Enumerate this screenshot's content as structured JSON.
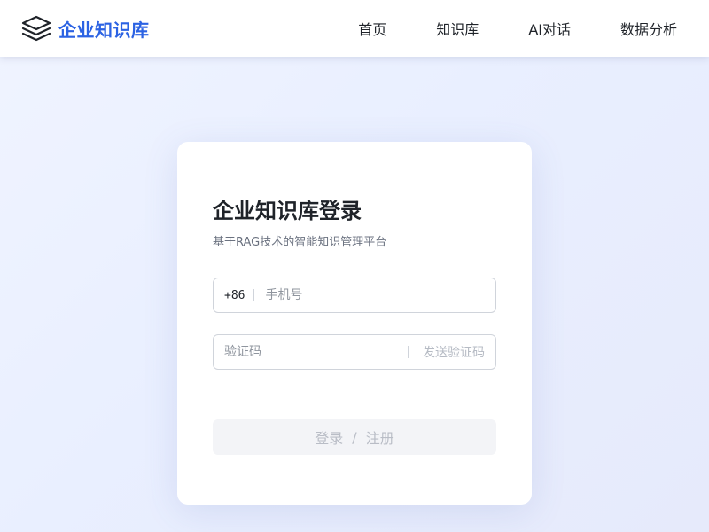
{
  "brand": {
    "name": "企业知识库",
    "icon": "layers-icon",
    "color": "#2b62e3"
  },
  "nav": {
    "items": [
      {
        "label": "首页"
      },
      {
        "label": "知识库"
      },
      {
        "label": "AI对话"
      },
      {
        "label": "数据分析"
      }
    ]
  },
  "login": {
    "title": "企业知识库登录",
    "subtitle": "基于RAG技术的智能知识管理平台",
    "phone": {
      "prefix": "+86",
      "placeholder": "手机号",
      "value": ""
    },
    "code": {
      "placeholder": "验证码",
      "value": "",
      "send_label": "发送验证码"
    },
    "submit": {
      "login_label": "登录",
      "separator": "/",
      "register_label": "注册"
    }
  }
}
